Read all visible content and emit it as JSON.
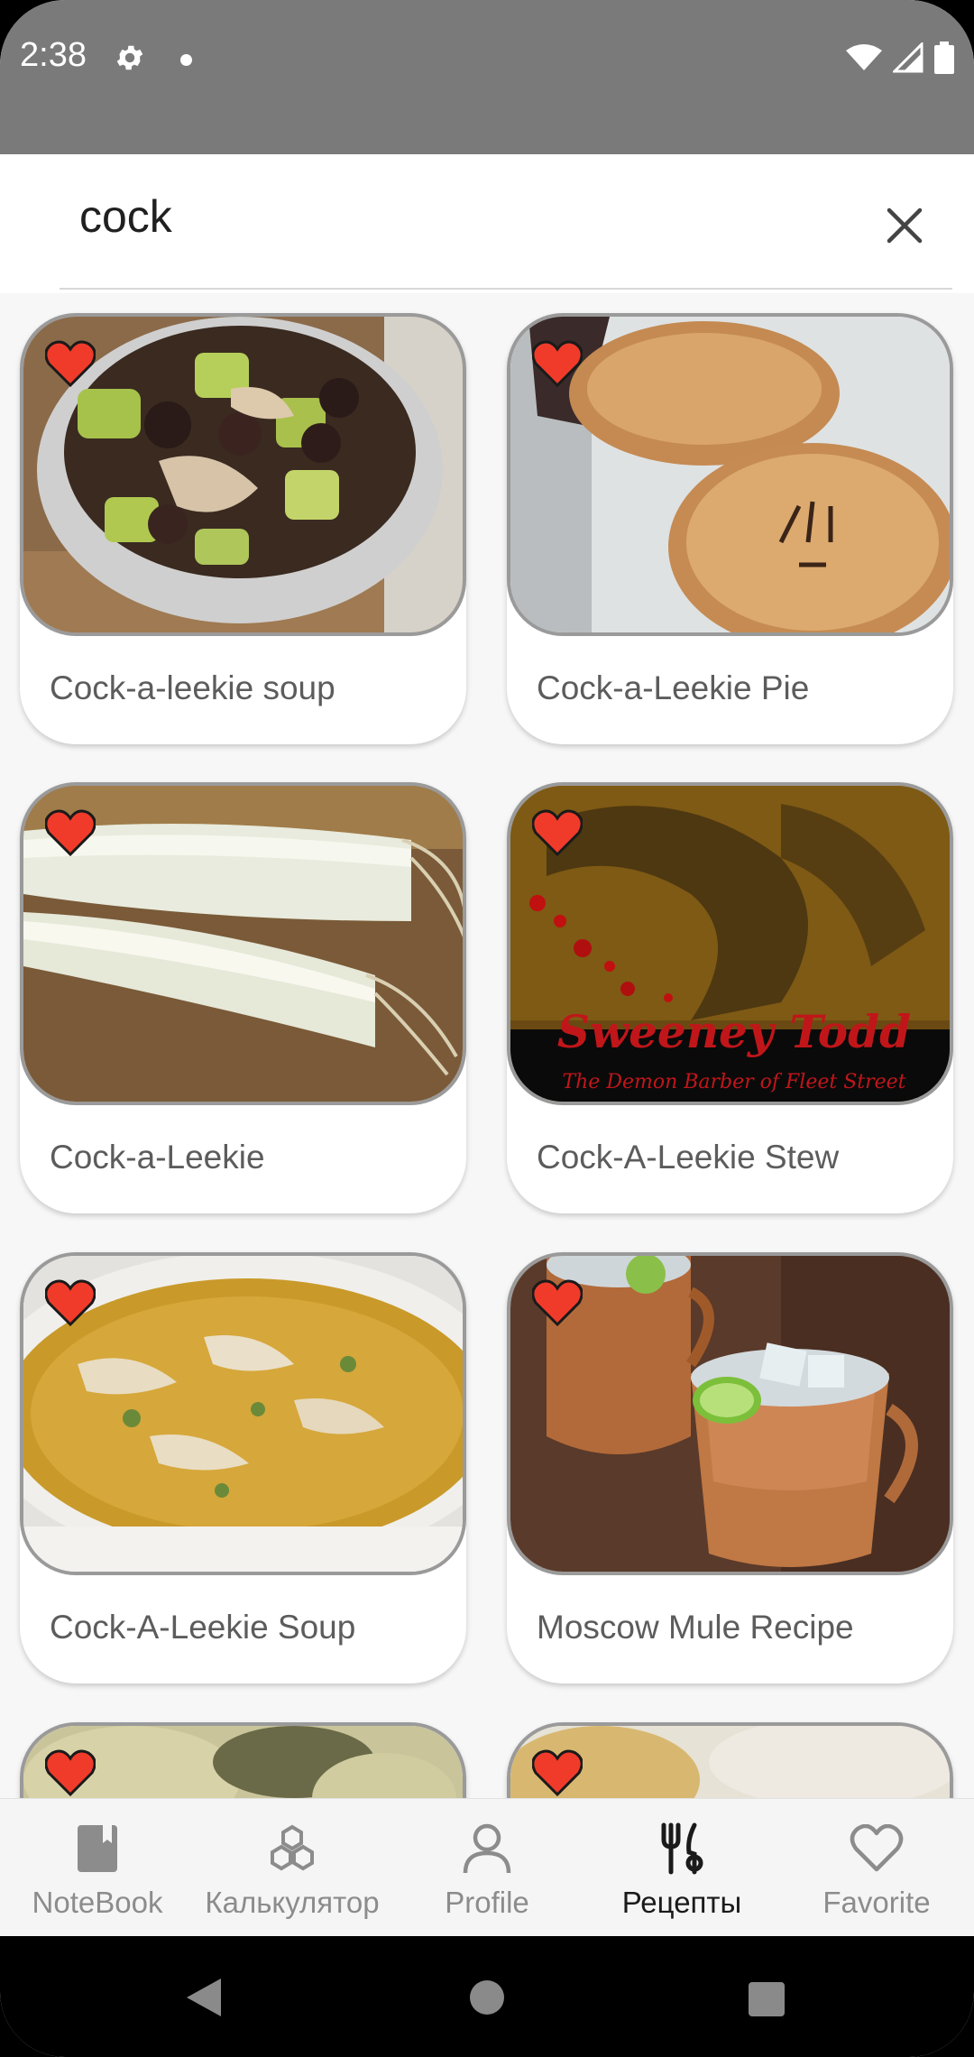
{
  "status_bar": {
    "time": "2:38"
  },
  "search": {
    "query": "cock"
  },
  "recipes": [
    {
      "title": "Cock-a-leekie soup"
    },
    {
      "title": "Cock-a-Leekie Pie"
    },
    {
      "title": "Cock-a-Leekie"
    },
    {
      "title": "Cock-A-Leekie Stew",
      "image_text": "Sweeney Todd",
      "image_subtext": "The Demon Barber of Fleet Street"
    },
    {
      "title": "Cock-A-Leekie Soup"
    },
    {
      "title": "Moscow Mule Recipe"
    },
    {
      "title": ""
    },
    {
      "title": ""
    }
  ],
  "bottom_nav": {
    "items": [
      {
        "label": "NoteBook",
        "icon": "notebook-icon"
      },
      {
        "label": "Калькулятор",
        "icon": "hexagon-calculator-icon"
      },
      {
        "label": "Profile",
        "icon": "person-icon"
      },
      {
        "label": "Рецепты",
        "icon": "fork-knife-icon",
        "active": true
      },
      {
        "label": "Favorite",
        "icon": "heart-outline-icon"
      }
    ]
  },
  "colors": {
    "status_bar_bg": "#7a7a7a",
    "heart_red": "#f03b2a",
    "active_nav": "#1a1a1a",
    "inactive_nav": "#8c8c8c"
  }
}
